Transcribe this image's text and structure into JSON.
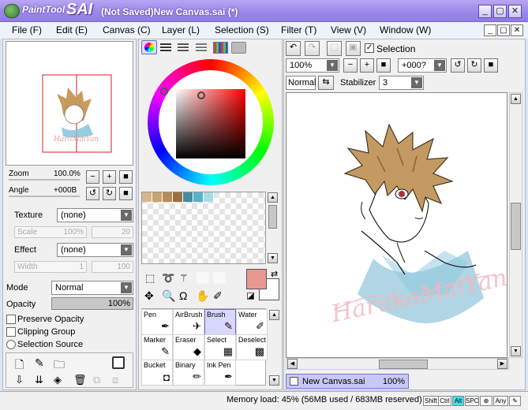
{
  "app": {
    "logo_text": "PaintTool",
    "logo_sai": "SAI",
    "window_title": "(Not Saved)New Canvas.sai (*)"
  },
  "window_buttons": [
    "_",
    "▢",
    "✕"
  ],
  "menu": [
    "File (F)",
    "Edit (E)",
    "Canvas (C)",
    "Layer (L)",
    "Selection (S)",
    "Filter (T)",
    "View (V)",
    "Window (W)"
  ],
  "navigator": {
    "zoom_label": "Zoom",
    "zoom_value": "100.0%",
    "angle_label": "Angle",
    "angle_value": "+000B"
  },
  "layer_props": {
    "texture_label": "Texture",
    "texture_value": "(none)",
    "scale_label": "Scale",
    "scale_value": "100%",
    "scale_num": "20",
    "effect_label": "Effect",
    "effect_value": "(none)",
    "width_label": "Width",
    "width_value": "1",
    "width_num": "100",
    "mode_label": "Mode",
    "mode_value": "Normal",
    "opacity_label": "Opacity",
    "opacity_value": "100%",
    "preserve_opacity": "Preserve Opacity",
    "clipping_group": "Clipping Group",
    "selection_source": "Selection Source"
  },
  "tools": [
    {
      "name": "Pen",
      "glyph": "✒"
    },
    {
      "name": "AirBrush",
      "glyph": "✈"
    },
    {
      "name": "Brush",
      "glyph": "✎"
    },
    {
      "name": "Water",
      "glyph": "✐"
    },
    {
      "name": "Marker",
      "glyph": "✎"
    },
    {
      "name": "Eraser",
      "glyph": "◆"
    },
    {
      "name": "Select",
      "glyph": "▦"
    },
    {
      "name": "Deselect",
      "glyph": "▩"
    },
    {
      "name": "Bucket",
      "glyph": "◘"
    },
    {
      "name": "Binary",
      "glyph": "✏"
    },
    {
      "name": "Ink Pen",
      "glyph": "✒"
    }
  ],
  "colors": {
    "primary": "#e89890",
    "secondary": "#ffffff",
    "accent": "#7b68ee"
  },
  "swatches": [
    "#d4b88a",
    "#c8a470",
    "#b88c58",
    "#9a7040",
    "#4a8aa0",
    "#5ab0c8",
    "#a8dce8"
  ],
  "canvas_toolbar": {
    "selection_label": "Selection",
    "zoom_value": "100%",
    "angle_value": "+000?",
    "mode_value": "Normal",
    "stabilizer_label": "Stabilizer",
    "stabilizer_value": "3"
  },
  "canvas_tab": {
    "name": "New Canvas.sai",
    "zoom": "100%"
  },
  "artwork": {
    "signature": "HarukaMaiYan"
  },
  "status": {
    "memory": "Memory load: 45% (56MB used / 683MB reserved)",
    "keys": [
      "Shift",
      "Ctrl",
      "Alt",
      "SPC",
      "⊕",
      "Any",
      "✎"
    ]
  }
}
